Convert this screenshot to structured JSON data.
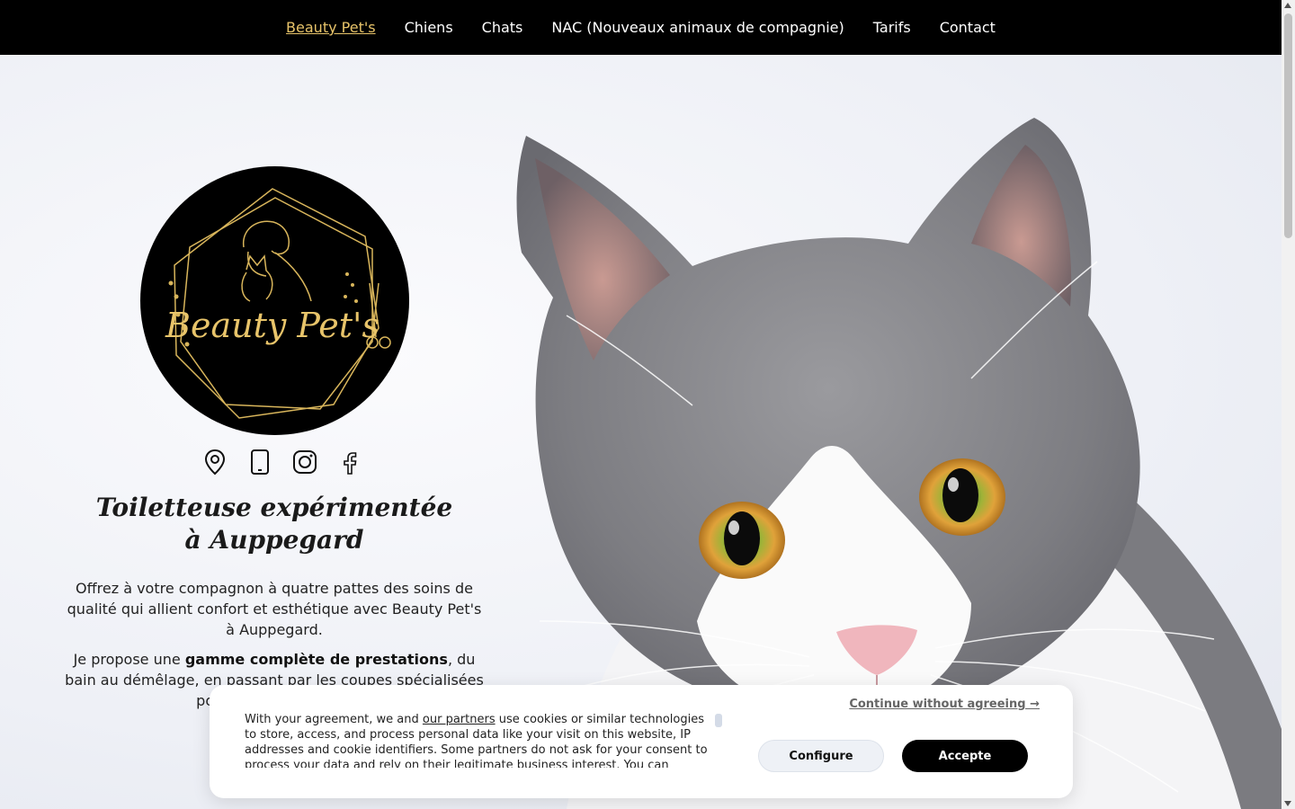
{
  "nav": {
    "items": [
      {
        "label": "Beauty Pet's",
        "active": true
      },
      {
        "label": "Chiens"
      },
      {
        "label": "Chats"
      },
      {
        "label": "NAC (Nouveaux animaux de compagnie)"
      },
      {
        "label": "Tarifs"
      },
      {
        "label": "Contact"
      }
    ]
  },
  "hero": {
    "logo_text": "Beauty Pet's",
    "socials": [
      "location-pin-icon",
      "phone-icon",
      "instagram-icon",
      "facebook-icon"
    ],
    "tagline": "Toiletteuse expérimentée à Auppegard",
    "paragraph1": "Offrez à votre compagnon à quatre pattes des soins de qualité qui allient confort et esthétique avec Beauty Pet's à Auppegard.",
    "paragraph2_before": "Je propose une ",
    "paragraph2_bold": "gamme complète de prestations",
    "paragraph2_after": ", du bain au démêlage, en passant par les coupes spécialisées pour toutes les races."
  },
  "cookie": {
    "text_before": "With your agreement, we and ",
    "link": "our partners",
    "text_after": " use cookies or similar technologies to store, access, and process personal data like your visit on this website, IP addresses and cookie identifiers. Some partners do not ask for your consent to process your data and rely on their legitimate business interest. You can",
    "skip": "Continue without agreeing →",
    "configure": "Configure",
    "accept": "Accepte"
  },
  "colors": {
    "accent": "#e8c46a",
    "nav_bg": "#000000"
  }
}
